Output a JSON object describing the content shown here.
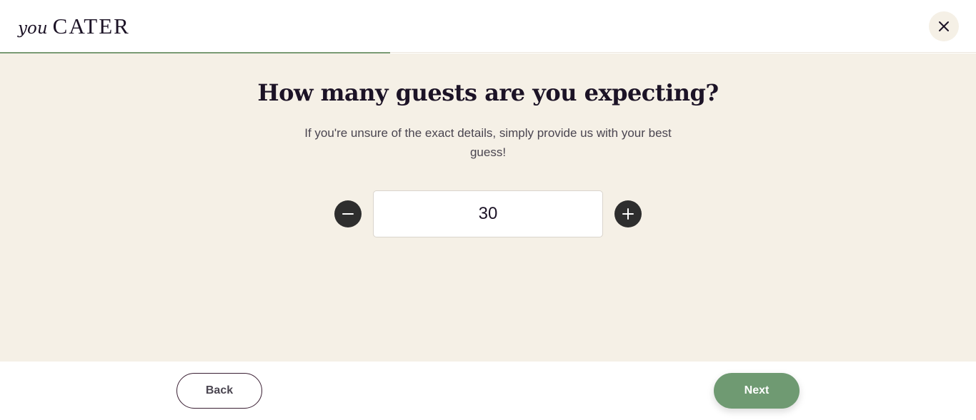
{
  "header": {
    "logo_you": "you",
    "logo_cater": "CATER",
    "close_icon": "close-icon"
  },
  "progress": {
    "fraction": 0.4,
    "color": "#7a9b74"
  },
  "main": {
    "title": "How many guests are you expecting?",
    "subtitle": "If you're unsure of the exact details, simply provide us with your best guess!",
    "guest_count": "30",
    "minus_icon": "minus-icon",
    "plus_icon": "plus-icon"
  },
  "footer": {
    "back_label": "Back",
    "next_label": "Next"
  },
  "colors": {
    "accent": "#6f9a72",
    "background": "#f5f0e6",
    "text": "#1c1326"
  }
}
